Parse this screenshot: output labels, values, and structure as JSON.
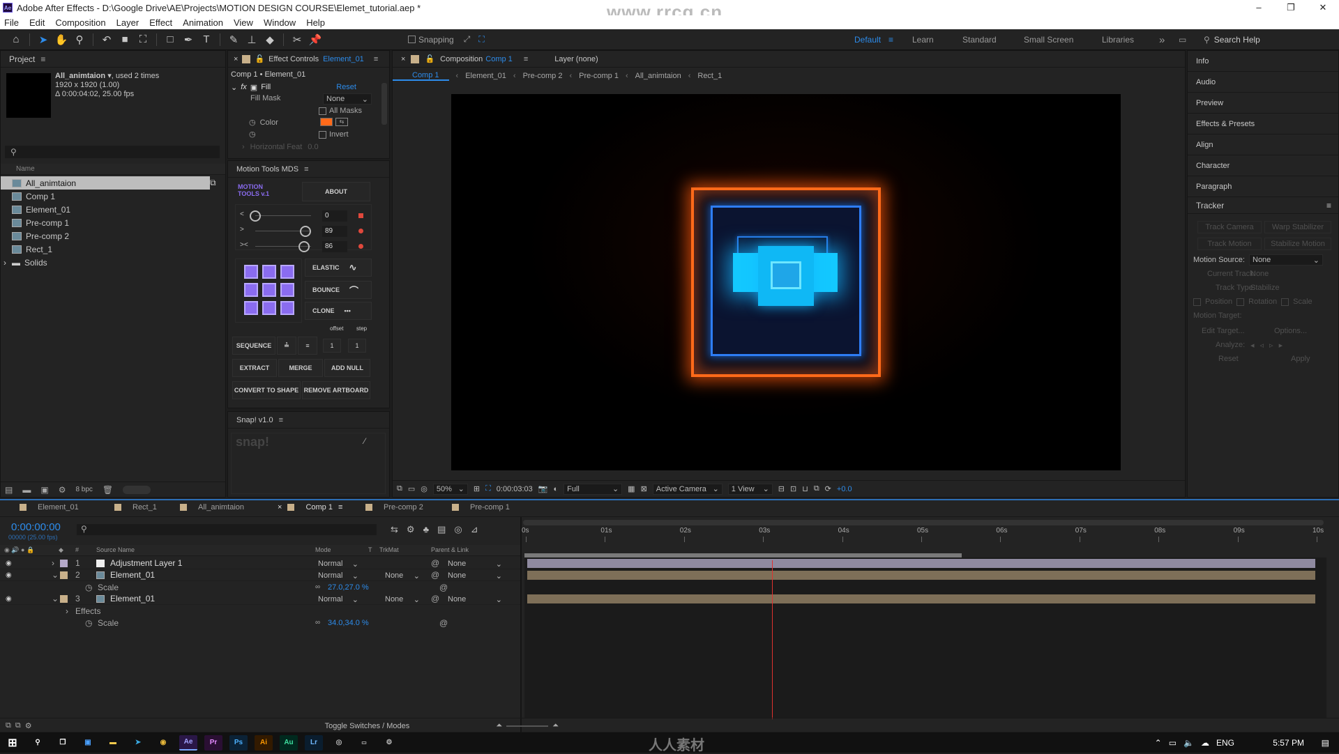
{
  "window": {
    "title": "Adobe After Effects - D:\\Google Drive\\AE\\Projects\\MOTION DESIGN COURSE\\Elemet_tutorial.aep *",
    "app_icon": "Ae",
    "watermark": "www.rrcg.cn",
    "controls": [
      "–",
      "❐",
      "✕"
    ]
  },
  "menu": [
    "File",
    "Edit",
    "Composition",
    "Layer",
    "Effect",
    "Animation",
    "View",
    "Window",
    "Help"
  ],
  "toolbar": {
    "snapping_label": "Snapping",
    "workspaces": [
      "Default",
      "Learn",
      "Standard",
      "Small Screen",
      "Libraries"
    ],
    "active_workspace": "Default",
    "more": "»",
    "search_help_placeholder": "Search Help"
  },
  "project": {
    "panel_title": "Project",
    "selected_name": "All_animtaion",
    "used_text": ", used 2 times",
    "dimensions": "1920 x 1920 (1.00)",
    "duration": "Δ 0:00:04:02, 25.00 fps",
    "search_placeholder": "",
    "name_header": "Name",
    "items": [
      {
        "name": "All_animtaion",
        "type": "comp",
        "selected": true
      },
      {
        "name": "Comp 1",
        "type": "comp"
      },
      {
        "name": "Element_01",
        "type": "comp"
      },
      {
        "name": "Pre-comp 1",
        "type": "comp"
      },
      {
        "name": "Pre-comp 2",
        "type": "comp"
      },
      {
        "name": "Rect_1",
        "type": "comp"
      },
      {
        "name": "Solids",
        "type": "folder"
      }
    ],
    "bpc": "8 bpc"
  },
  "effect_controls": {
    "tab_label": "Effect Controls",
    "tab_target": "Element_01",
    "subtitle": "Comp 1 • Element_01",
    "effect_name": "Fill",
    "reset": "Reset",
    "fill_mask_label": "Fill Mask",
    "fill_mask_value": "None",
    "all_masks": "All Masks",
    "color_label": "Color",
    "color_value": "#ff6a1a",
    "invert": "Invert",
    "horizontal_feather": "Horizontal Feat",
    "horizontal_feather_value": "0.0"
  },
  "motion_tools": {
    "panel_title": "Motion Tools MDS",
    "logo_line1": "MOTION",
    "logo_line2": "TOOLS v.1",
    "about": "ABOUT",
    "sliders": [
      {
        "icon": "<",
        "value": "0",
        "fraction": 0.0
      },
      {
        "icon": ">",
        "value": "89",
        "fraction": 1.0
      },
      {
        "icon": "><",
        "value": "86",
        "fraction": 0.97
      }
    ],
    "elastic": "ELASTIC",
    "bounce": "BOUNCE",
    "clone": "CLONE",
    "offset": "offset",
    "step": "step",
    "sequence": "SEQUENCE",
    "seq_val1": "1",
    "seq_val2": "1",
    "extract": "EXTRACT",
    "merge": "MERGE",
    "add_null": "ADD NULL",
    "convert_to_shape": "CONVERT TO SHAPE",
    "remove_artboard": "REMOVE ARTBOARD",
    "accent": "#8a6cf0"
  },
  "snap": {
    "panel_title": "Snap! v1.0",
    "logo": "snap!"
  },
  "composition": {
    "tab_label": "Composition",
    "tab_target": "Comp 1",
    "layer_tab": "Layer (none)",
    "breadcrumbs": [
      "Comp 1",
      "Element_01",
      "Pre-comp 2",
      "Pre-comp 1",
      "All_animtaion",
      "Rect_1"
    ],
    "zoom": "50%",
    "timecode": "0:00:03:03",
    "resolution": "Full",
    "camera": "Active Camera",
    "views": "1 View",
    "exposure": "+0.0"
  },
  "right_panels": {
    "items": [
      "Info",
      "Audio",
      "Preview",
      "Effects & Presets",
      "Align",
      "Character",
      "Paragraph"
    ],
    "tracker": {
      "title": "Tracker",
      "track_camera": "Track Camera",
      "warp_stabilizer": "Warp Stabilizer",
      "track_motion": "Track Motion",
      "stabilize_motion": "Stabilize Motion",
      "motion_source_label": "Motion Source:",
      "motion_source_value": "None",
      "current_track_label": "Current Track:",
      "current_track_value": "None",
      "track_type_label": "Track Type:",
      "track_type_value": "Stabilize",
      "position": "Position",
      "rotation": "Rotation",
      "scale": "Scale",
      "motion_target": "Motion Target:",
      "edit_target": "Edit Target...",
      "options": "Options...",
      "analyze": "Analyze:",
      "reset": "Reset",
      "apply": "Apply"
    }
  },
  "timeline": {
    "tabs": [
      {
        "label": "Element_01"
      },
      {
        "label": "Rect_1"
      },
      {
        "label": "All_animtaion"
      },
      {
        "label": "Comp 1",
        "active": true
      },
      {
        "label": "Pre-comp 2"
      },
      {
        "label": "Pre-comp 1"
      }
    ],
    "current_time": "0:00:00:00",
    "fps_note": "00000 (25.00 fps)",
    "columns": {
      "num": "#",
      "source": "Source Name",
      "mode": "Mode",
      "t": "T",
      "trkmat": "TrkMat",
      "parent": "Parent & Link"
    },
    "layers": [
      {
        "num": "1",
        "name": "Adjustment Layer 1",
        "mode": "Normal",
        "trkmat": "",
        "parent": "None",
        "color": "#b5a9c9",
        "type": "adjustment"
      },
      {
        "num": "2",
        "name": "Element_01",
        "mode": "Normal",
        "trkmat": "None",
        "parent": "None",
        "color": "#c8b08a",
        "type": "comp",
        "expanded": true,
        "props": [
          {
            "name": "Scale",
            "value": "27.0,27.0 %"
          }
        ]
      },
      {
        "num": "3",
        "name": "Element_01",
        "mode": "Normal",
        "trkmat": "None",
        "parent": "None",
        "color": "#c8b08a",
        "type": "comp",
        "expanded": true,
        "effects_label": "Effects",
        "props": [
          {
            "name": "Scale",
            "value": "34.0,34.0 %"
          }
        ]
      }
    ],
    "ruler": [
      "0s",
      "01s",
      "02s",
      "03s",
      "04s",
      "05s",
      "06s",
      "07s",
      "08s",
      "09s",
      "10s"
    ],
    "work_area_end_fraction": 0.55,
    "playhead_fraction": 0.31,
    "toggle_label": "Toggle Switches / Modes"
  },
  "taskbar": {
    "apps": [
      "Ps",
      "Ae",
      "Pr",
      "Ps",
      "Ai",
      "Au",
      "Lr"
    ],
    "lang": "ENG",
    "time": "5:57 PM",
    "watermark": "人人素材"
  }
}
